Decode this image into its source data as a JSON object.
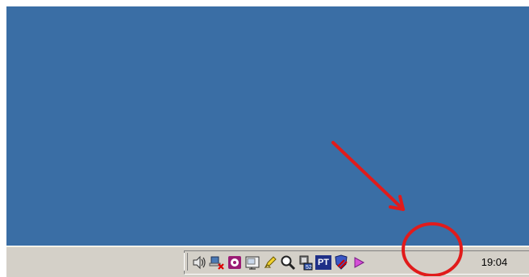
{
  "desktop": {
    "background_color": "#3a6ea5"
  },
  "taskbar": {
    "background_color": "#d4d0c8",
    "tray": {
      "icons": [
        {
          "name": "speaker-icon"
        },
        {
          "name": "network-disconnected-icon"
        },
        {
          "name": "media-disc-icon"
        },
        {
          "name": "display-settings-icon"
        },
        {
          "name": "pencil-tool-icon"
        },
        {
          "name": "search-magnifier-icon"
        },
        {
          "name": "system-monitor-icon"
        },
        {
          "name": "language-bar-icon",
          "label": "PT"
        },
        {
          "name": "antivirus-icon"
        },
        {
          "name": "media-play-icon"
        }
      ],
      "clock": "19:04"
    }
  },
  "annotation": {
    "color": "#e11b1b"
  }
}
